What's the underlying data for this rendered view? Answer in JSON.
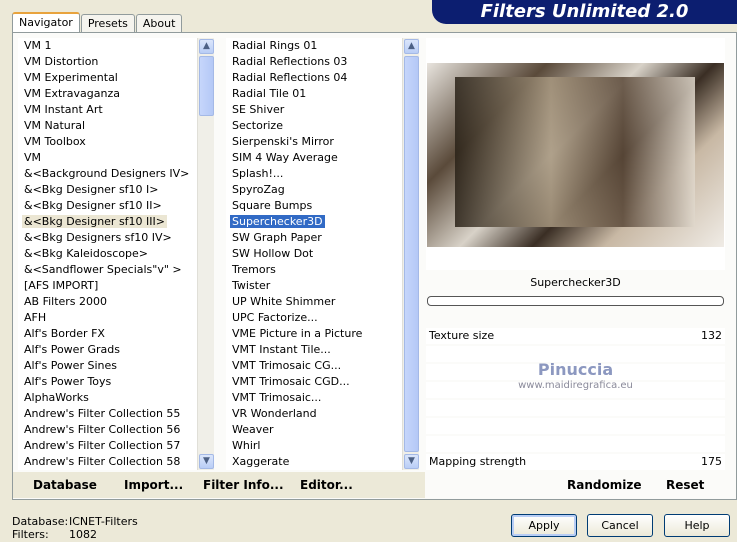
{
  "title": "Filters Unlimited 2.0",
  "tabs": [
    "Navigator",
    "Presets",
    "About"
  ],
  "categories": [
    "VM 1",
    "VM Distortion",
    "VM Experimental",
    "VM Extravaganza",
    "VM Instant Art",
    "VM Natural",
    "VM Toolbox",
    "VM",
    "&<Background Designers IV>",
    "&<Bkg Designer sf10 I>",
    "&<Bkg Designer sf10 II>",
    "&<Bkg Designer sf10 III>",
    "&<Bkg Designers sf10 IV>",
    "&<Bkg Kaleidoscope>",
    "&<Sandflower Specials\"v\" >",
    "[AFS IMPORT]",
    "AB Filters 2000",
    "AFH",
    "Alf's Border FX",
    "Alf's Power Grads",
    "Alf's Power Sines",
    "Alf's Power Toys",
    "AlphaWorks",
    "Andrew's Filter Collection 55",
    "Andrew's Filter Collection 56",
    "Andrew's Filter Collection 57",
    "Andrew's Filter Collection 58"
  ],
  "selected_category": "&<Bkg Designer sf10 III>",
  "filters": [
    "Radial  Rings 01",
    "Radial Reflections 03",
    "Radial Reflections 04",
    "Radial Tile 01",
    "SE Shiver",
    "Sectorize",
    "Sierpenski's Mirror",
    "SIM 4 Way Average",
    "Splash!...",
    "SpyroZag",
    "Square Bumps",
    "Superchecker3D",
    "SW Graph Paper",
    "SW Hollow Dot",
    "Tremors",
    "Twister",
    "UP White Shimmer",
    "UPC Factorize...",
    "VME Picture in a Picture",
    "VMT Instant Tile...",
    "VMT Trimosaic CG...",
    "VMT Trimosaic CGD...",
    "VMT Trimosaic...",
    "VR Wonderland",
    "Weaver",
    "Whirl",
    "Xaggerate"
  ],
  "selected_filter": "Superchecker3D",
  "preview": {
    "filter_name": "Superchecker3D",
    "watermark_name": "Pinuccia",
    "watermark_url": "www.maidiregrafica.eu"
  },
  "params": [
    {
      "label": "Texture size",
      "value": "132",
      "max": 255
    },
    {
      "label": "Mapping strength",
      "value": "175",
      "max": 255
    }
  ],
  "buttons": {
    "database": "Database",
    "import": "Import...",
    "filter_info": "Filter Info...",
    "editor": "Editor...",
    "randomize": "Randomize",
    "reset": "Reset",
    "apply": "Apply",
    "cancel": "Cancel",
    "help": "Help"
  },
  "status": {
    "database_label": "Database:",
    "database_value": "ICNET-Filters",
    "filters_label": "Filters:",
    "filters_value": "1082"
  }
}
